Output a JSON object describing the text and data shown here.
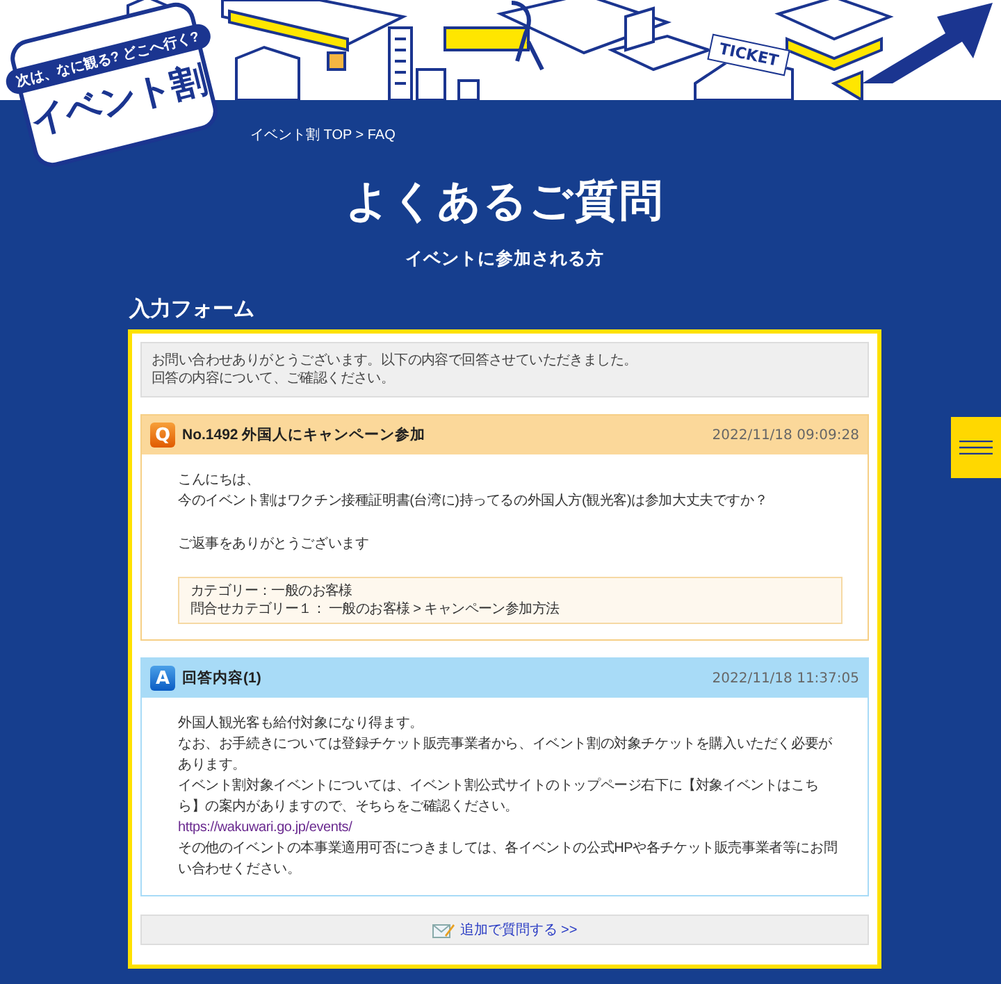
{
  "header": {
    "sign_text": "TICKET",
    "logo": {
      "tagline": "次は、なに観る? どこへ行く?",
      "name": "イベント割"
    }
  },
  "breadcrumb": "イベント割 TOP > FAQ",
  "page_title": "よくあるご質問",
  "subtitle": "イベントに参加される方",
  "section_heading": "入力フォーム",
  "notice": [
    "お問い合わせありがとうございます。以下の内容で回答させていただきました。",
    "回答の内容について、ご確認ください。"
  ],
  "cards": [
    {
      "kind": "question",
      "badge": "Q",
      "title": "No.1492 外国人にキャンペーン参加",
      "date": "2022/11/18 09:09:28",
      "paragraphs": [
        {
          "kind": "text",
          "lines": [
            "こんにちは、",
            "今のイベント割はワクチン接種証明書(台湾に)持ってるの外国人方(観光客)は参加大丈夫ですか？"
          ]
        },
        {
          "kind": "text",
          "lines": [
            "ご返事をありがとうございます"
          ]
        }
      ],
      "category": [
        "カテゴリー：一般のお客様",
        "問合せカテゴリー１： 一般のお客様 > キャンペーン参加方法"
      ]
    },
    {
      "kind": "answer",
      "badge": "A",
      "title": "回答内容(1)",
      "date": "2022/11/18 11:37:05",
      "paragraphs": [
        {
          "kind": "text",
          "lines": [
            "外国人観光客も給付対象になり得ます。",
            "なお、お手続きについては登録チケット販売事業者から、イベント割の対象チケットを購入いただく必要があります。",
            "イベント割対象イベントについては、イベント割公式サイトのトップページ右下に【対象イベントはこちら】の案内がありますので、そちらをご確認ください。"
          ]
        },
        {
          "kind": "link",
          "lines": [
            "https://wakuwari.go.jp/events/"
          ]
        },
        {
          "kind": "text",
          "lines": [
            "その他のイベントの本事業適用可否につきましては、各イベントの公式HPや各チケット販売事業者等にお問い合わせください。"
          ]
        }
      ]
    }
  ],
  "follow_up_button": "追加で質問する >>"
}
